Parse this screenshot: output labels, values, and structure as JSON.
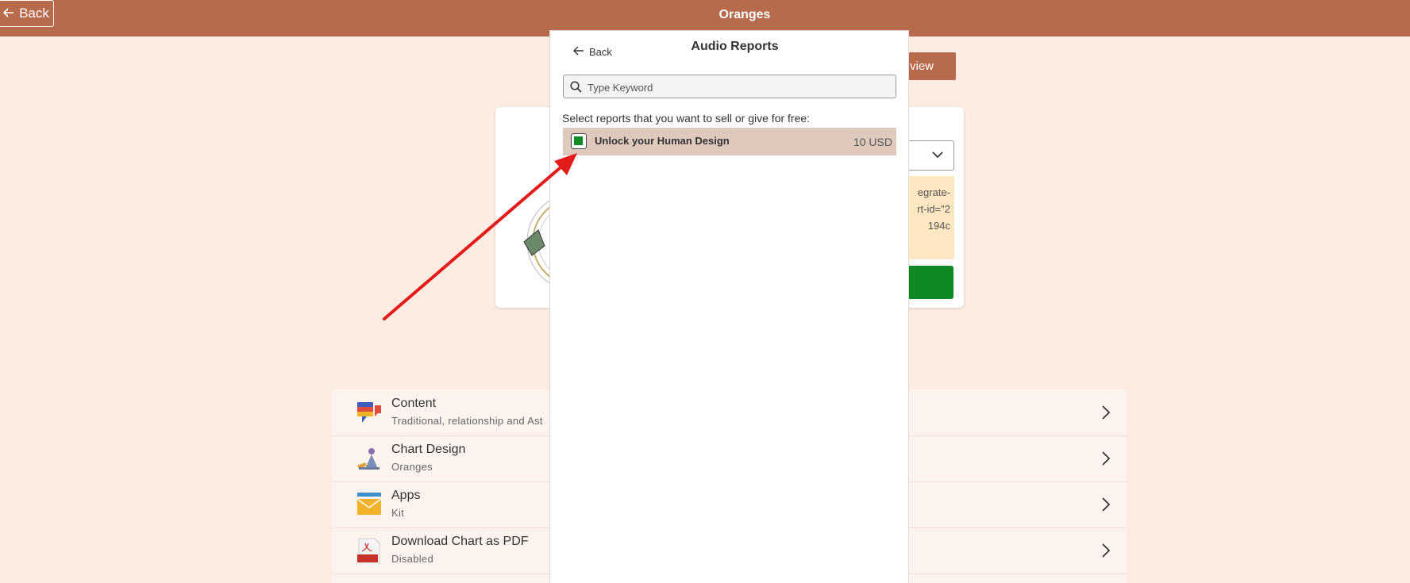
{
  "topbar": {
    "back_label": "Back",
    "title": "Oranges"
  },
  "background_card": {
    "preview_label": "view",
    "code_lines": [
      "egrate-",
      "rt-id=\"2",
      "194c"
    ]
  },
  "list": {
    "items": [
      {
        "title": "Content",
        "subtitle": "Traditional, relationship and Ast",
        "icon": "chat-flags-icon"
      },
      {
        "title": "Chart Design",
        "subtitle": "Oranges",
        "icon": "design-tools-icon"
      },
      {
        "title": "Apps",
        "subtitle": "Kit",
        "icon": "envelope-icon"
      },
      {
        "title": "Download Chart as PDF",
        "subtitle": "Disabled",
        "icon": "pdf-icon"
      }
    ]
  },
  "modal": {
    "back_label": "Back",
    "title": "Audio Reports",
    "search_placeholder": "Type Keyword",
    "instruction": "Select reports that you want to sell or give for free:",
    "reports": [
      {
        "name": "Unlock your Human Design",
        "price": "10 USD",
        "checked": true
      }
    ]
  },
  "colors": {
    "brand": "#b86a4c",
    "background": "#fcece1",
    "selected_row": "#dfc9bd",
    "checkbox_fill": "#0e8a24",
    "annotation_arrow": "#e31b1b"
  }
}
